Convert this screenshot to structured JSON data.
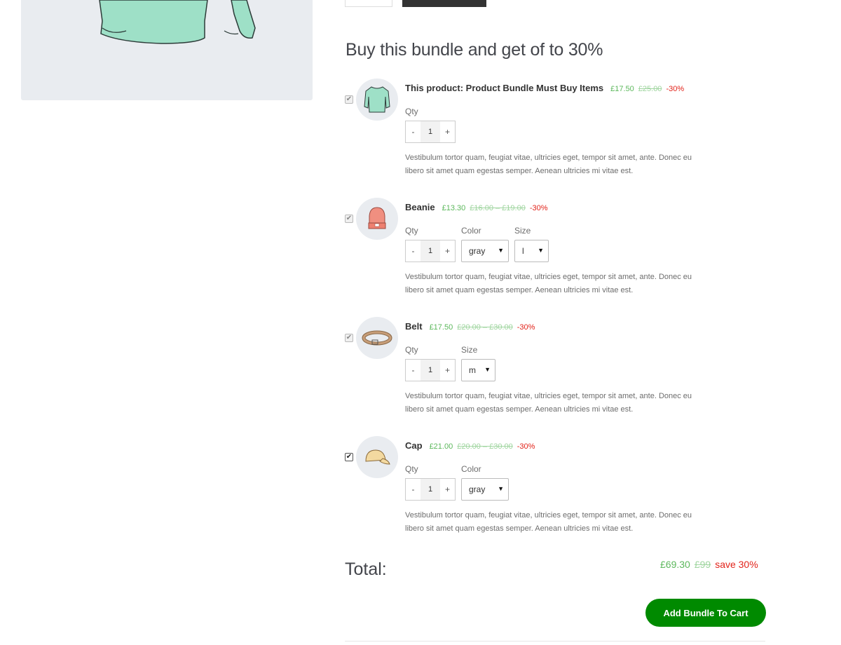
{
  "bundle": {
    "title": "Buy this bundle and get of to 30%",
    "qty_label": "Qty",
    "color_label": "Color",
    "size_label": "Size",
    "description": "Vestibulum tortor quam, feugiat vitae, ultricies eget, tempor sit amet, ante. Donec eu libero sit amet quam egestas semper. Aenean ultricies mi vitae est.",
    "items": [
      {
        "name": "This product: Product Bundle Must Buy Items",
        "price": "£17.50",
        "old_price": "£25.00",
        "discount": "-30%",
        "qty": "1",
        "checked": true,
        "icon": "sweater-icon"
      },
      {
        "name": "Beanie",
        "price": "£13.30",
        "old_price": "£16.00 – £19.00",
        "discount": "-30%",
        "qty": "1",
        "color": "gray",
        "size": "l",
        "checked": true,
        "icon": "beanie-icon"
      },
      {
        "name": "Belt",
        "price": "£17.50",
        "old_price": "£20.00 – £30.00",
        "discount": "-30%",
        "qty": "1",
        "size": "m",
        "checked": true,
        "icon": "belt-icon"
      },
      {
        "name": "Cap",
        "price": "£21.00",
        "old_price": "£20.00 – £30.00",
        "discount": "-30%",
        "qty": "1",
        "color": "gray",
        "checked": true,
        "icon": "cap-icon"
      }
    ],
    "total_label": "Total:",
    "total_price": "£69.30",
    "total_old_price": "£99",
    "total_save": "save 30%",
    "add_button_label": "Add Bundle To Cart"
  },
  "colors": {
    "price_green": "#5cb85c",
    "discount_red": "#e2231a",
    "button_green": "#008a00"
  }
}
